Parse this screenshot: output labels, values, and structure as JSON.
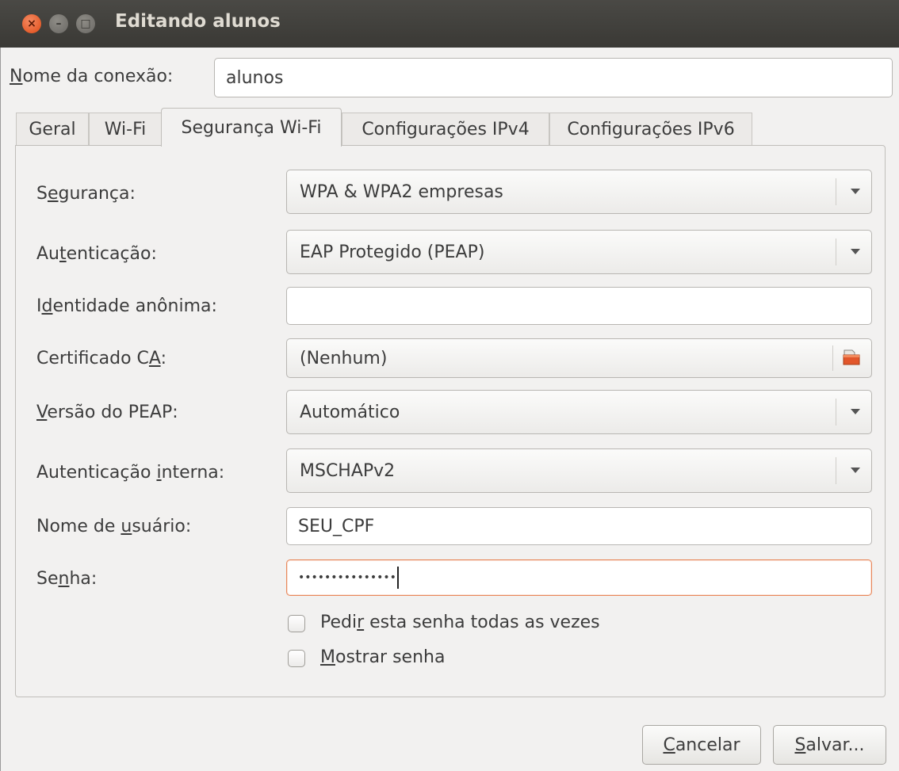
{
  "window": {
    "title": "Editando alunos",
    "close_glyph": "×",
    "min_glyph": "–",
    "max_glyph": "□"
  },
  "connection": {
    "name_label_mnemonic": "N",
    "name_label_rest": "ome da conexão:",
    "name_value": "alunos"
  },
  "tabs": [
    {
      "label": "Geral"
    },
    {
      "label": "Wi-Fi"
    },
    {
      "label": "Segurança Wi-Fi"
    },
    {
      "label": "Configurações IPv4"
    },
    {
      "label": "Configurações IPv6"
    }
  ],
  "active_tab": "Segurança Wi-Fi",
  "form": {
    "security": {
      "label_pre": "S",
      "label_mn": "e",
      "label_post": "gurança:",
      "value": "WPA & WPA2 empresas"
    },
    "auth": {
      "label_pre": "Au",
      "label_mn": "t",
      "label_post": "enticação:",
      "value": "EAP Protegido (PEAP)"
    },
    "anon_identity": {
      "label_pre": "I",
      "label_mn": "d",
      "label_post": "entidade anônima:",
      "value": ""
    },
    "ca_cert": {
      "label_pre": "Certificado C",
      "label_mn": "A",
      "label_post": ":",
      "value": "(Nenhum)",
      "icon": "folder-icon"
    },
    "peap_version": {
      "label_pre": "",
      "label_mn": "V",
      "label_post": "ersão do PEAP:",
      "value": "Automático"
    },
    "inner_auth": {
      "label_pre": "Autenticação ",
      "label_mn": "i",
      "label_post": "nterna:",
      "value": "MSCHAPv2"
    },
    "username": {
      "label_pre": "Nome de ",
      "label_mn": "u",
      "label_post": "suário:",
      "value": "SEU_CPF"
    },
    "password": {
      "label_pre": "Se",
      "label_mn": "n",
      "label_post": "ha:",
      "value": "•••••••••••••••"
    },
    "ask_password": {
      "label_pre": "Pedi",
      "label_mn": "r",
      "label_post": " esta senha todas as vezes",
      "checked": false
    },
    "show_password": {
      "label_pre": "",
      "label_mn": "M",
      "label_post": "ostrar senha",
      "checked": false
    }
  },
  "buttons": {
    "cancel_mn": "C",
    "cancel_rest": "ancelar",
    "save_mn": "S",
    "save_rest": "alvar..."
  },
  "colors": {
    "accent_focus": "#e8875a",
    "titlebar": "#3c3b37",
    "close_button": "#e9541f"
  }
}
